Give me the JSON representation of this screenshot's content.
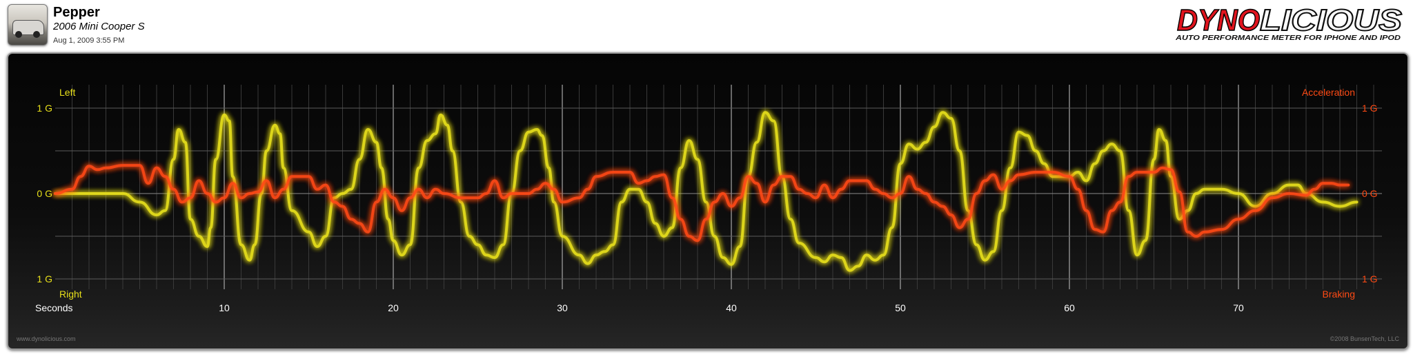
{
  "header": {
    "name": "Pepper",
    "model": "2006 Mini Cooper S",
    "date": "Aug 1, 2009 3:55 PM"
  },
  "brand": {
    "logo_part1": "DYNO",
    "logo_part2": "LICIOUS",
    "tagline": "AUTO PERFORMANCE METER FOR IPHONE AND IPOD"
  },
  "footer": {
    "left": "www.dynolicious.com",
    "right": "©2008 BunsenTech, LLC"
  },
  "colors": {
    "lateral": "#e8e01a",
    "longitudinal": "#ff4a14",
    "brand_red": "#e0141e"
  },
  "chart_data": {
    "type": "line",
    "xlabel": "Seconds",
    "x_ticks": [
      10,
      20,
      30,
      40,
      50,
      60,
      70
    ],
    "xlim": [
      0,
      78
    ],
    "ylim": [
      -1.1,
      1.1
    ],
    "grid": true,
    "left_axis": {
      "top_label": "Left",
      "bottom_label": "Right",
      "tick_labels": [
        "1 G",
        "0 G",
        "1 G"
      ]
    },
    "right_axis": {
      "top_label": "Acceleration",
      "bottom_label": "Braking",
      "tick_labels": [
        "1 G",
        "0 G",
        "1 G"
      ]
    },
    "series": [
      {
        "name": "Left",
        "color": "#e8e01a",
        "points": [
          [
            0,
            0
          ],
          [
            2,
            0
          ],
          [
            4,
            0
          ],
          [
            5,
            -0.1
          ],
          [
            6,
            -0.25
          ],
          [
            6.5,
            -0.2
          ],
          [
            7,
            0.4
          ],
          [
            7.3,
            0.75
          ],
          [
            7.7,
            0.6
          ],
          [
            8,
            -0.3
          ],
          [
            8.5,
            -0.5
          ],
          [
            9,
            -0.62
          ],
          [
            9.2,
            -0.4
          ],
          [
            9.5,
            0.4
          ],
          [
            10,
            0.92
          ],
          [
            10.3,
            0.85
          ],
          [
            10.5,
            0.2
          ],
          [
            11,
            -0.6
          ],
          [
            11.5,
            -0.78
          ],
          [
            11.8,
            -0.6
          ],
          [
            12.2,
            0
          ],
          [
            12.5,
            0.5
          ],
          [
            13,
            0.8
          ],
          [
            13.3,
            0.7
          ],
          [
            13.5,
            0.3
          ],
          [
            14,
            -0.2
          ],
          [
            15,
            -0.45
          ],
          [
            15.5,
            -0.62
          ],
          [
            16,
            -0.5
          ],
          [
            16.5,
            -0.05
          ],
          [
            17,
            0
          ],
          [
            17.5,
            0.05
          ],
          [
            18,
            0.4
          ],
          [
            18.5,
            0.75
          ],
          [
            19,
            0.6
          ],
          [
            19.3,
            0.3
          ],
          [
            19.7,
            -0.3
          ],
          [
            20,
            -0.55
          ],
          [
            20.5,
            -0.72
          ],
          [
            21,
            -0.6
          ],
          [
            21.5,
            0.3
          ],
          [
            22,
            0.62
          ],
          [
            22.5,
            0.7
          ],
          [
            22.8,
            0.92
          ],
          [
            23.2,
            0.8
          ],
          [
            23.5,
            0.5
          ],
          [
            24,
            -0.1
          ],
          [
            24.5,
            -0.5
          ],
          [
            25,
            -0.6
          ],
          [
            25.5,
            -0.72
          ],
          [
            26,
            -0.75
          ],
          [
            26.5,
            -0.6
          ],
          [
            27,
            0
          ],
          [
            27.5,
            0.5
          ],
          [
            28,
            0.72
          ],
          [
            28.5,
            0.75
          ],
          [
            28.8,
            0.68
          ],
          [
            29.2,
            0.3
          ],
          [
            29.5,
            -0.1
          ],
          [
            30,
            -0.5
          ],
          [
            31,
            -0.72
          ],
          [
            31.5,
            -0.82
          ],
          [
            32,
            -0.72
          ],
          [
            32.5,
            -0.68
          ],
          [
            33,
            -0.6
          ],
          [
            33.5,
            -0.1
          ],
          [
            34,
            0.05
          ],
          [
            34.5,
            0.05
          ],
          [
            35,
            -0.1
          ],
          [
            35.5,
            -0.35
          ],
          [
            36,
            -0.5
          ],
          [
            36.5,
            -0.4
          ],
          [
            37,
            0.3
          ],
          [
            37.5,
            0.62
          ],
          [
            38,
            0.4
          ],
          [
            38.5,
            -0.1
          ],
          [
            39,
            -0.5
          ],
          [
            39.5,
            -0.75
          ],
          [
            40,
            -0.83
          ],
          [
            40.5,
            -0.62
          ],
          [
            41,
            0.2
          ],
          [
            41.5,
            0.6
          ],
          [
            42,
            0.95
          ],
          [
            42.5,
            0.85
          ],
          [
            43,
            0.2
          ],
          [
            43.5,
            -0.3
          ],
          [
            44,
            -0.58
          ],
          [
            45,
            -0.75
          ],
          [
            45.5,
            -0.8
          ],
          [
            46,
            -0.72
          ],
          [
            46.5,
            -0.75
          ],
          [
            47,
            -0.9
          ],
          [
            47.5,
            -0.85
          ],
          [
            48,
            -0.72
          ],
          [
            48.5,
            -0.78
          ],
          [
            49,
            -0.72
          ],
          [
            49.5,
            -0.4
          ],
          [
            50,
            0.35
          ],
          [
            50.5,
            0.58
          ],
          [
            51,
            0.52
          ],
          [
            51.5,
            0.6
          ],
          [
            52,
            0.78
          ],
          [
            52.5,
            0.95
          ],
          [
            53,
            0.88
          ],
          [
            53.5,
            0.5
          ],
          [
            54,
            -0.2
          ],
          [
            54.5,
            -0.6
          ],
          [
            55,
            -0.78
          ],
          [
            55.5,
            -0.68
          ],
          [
            56,
            -0.2
          ],
          [
            56.5,
            0.3
          ],
          [
            57,
            0.72
          ],
          [
            57.5,
            0.68
          ],
          [
            58,
            0.5
          ],
          [
            58.5,
            0.35
          ],
          [
            59,
            0.2
          ],
          [
            59.5,
            0.2
          ],
          [
            60,
            0.2
          ],
          [
            60.5,
            0.25
          ],
          [
            61,
            0.15
          ],
          [
            61.5,
            0.35
          ],
          [
            62,
            0.5
          ],
          [
            62.5,
            0.58
          ],
          [
            63,
            0.5
          ],
          [
            63.5,
            -0.2
          ],
          [
            64,
            -0.72
          ],
          [
            64.5,
            -0.55
          ],
          [
            65,
            0.4
          ],
          [
            65.3,
            0.75
          ],
          [
            65.7,
            0.62
          ],
          [
            66,
            0.2
          ],
          [
            66.5,
            -0.3
          ],
          [
            67,
            -0.2
          ],
          [
            67.5,
            0
          ],
          [
            68,
            0.05
          ],
          [
            69,
            0.05
          ],
          [
            70,
            0
          ],
          [
            71,
            -0.15
          ],
          [
            72,
            0
          ],
          [
            73,
            0.1
          ],
          [
            73.5,
            0.1
          ],
          [
            74,
            0
          ],
          [
            75,
            -0.1
          ],
          [
            76,
            -0.15
          ],
          [
            77,
            -0.1
          ]
        ]
      },
      {
        "name": "Acceleration",
        "color": "#ff4a14",
        "points": [
          [
            0,
            0
          ],
          [
            1,
            0.05
          ],
          [
            1.5,
            0.2
          ],
          [
            2,
            0.32
          ],
          [
            2.5,
            0.28
          ],
          [
            3,
            0.3
          ],
          [
            4,
            0.33
          ],
          [
            5,
            0.33
          ],
          [
            5.5,
            0.12
          ],
          [
            6,
            0.3
          ],
          [
            6.5,
            0.2
          ],
          [
            7,
            0.05
          ],
          [
            7.5,
            -0.1
          ],
          [
            8,
            -0.05
          ],
          [
            8.5,
            0.15
          ],
          [
            9,
            0
          ],
          [
            9.5,
            -0.1
          ],
          [
            10,
            -0.05
          ],
          [
            10.5,
            0.12
          ],
          [
            11,
            -0.05
          ],
          [
            11.5,
            0
          ],
          [
            12,
            0.02
          ],
          [
            12.5,
            0.15
          ],
          [
            13,
            -0.05
          ],
          [
            13.5,
            0.05
          ],
          [
            14,
            0.2
          ],
          [
            15,
            0.2
          ],
          [
            15.5,
            0.05
          ],
          [
            16,
            0.1
          ],
          [
            16.5,
            -0.1
          ],
          [
            17,
            -0.15
          ],
          [
            17.5,
            -0.3
          ],
          [
            18,
            -0.35
          ],
          [
            18.5,
            -0.45
          ],
          [
            19,
            -0.1
          ],
          [
            19.5,
            0.05
          ],
          [
            20,
            -0.05
          ],
          [
            20.5,
            -0.2
          ],
          [
            21,
            -0.05
          ],
          [
            21.5,
            0.05
          ],
          [
            22,
            -0.05
          ],
          [
            22.5,
            0.05
          ],
          [
            23,
            0
          ],
          [
            24,
            -0.05
          ],
          [
            25,
            -0.05
          ],
          [
            25.5,
            0
          ],
          [
            26,
            0.15
          ],
          [
            26.5,
            -0.05
          ],
          [
            27,
            0
          ],
          [
            28,
            0
          ],
          [
            28.5,
            0.05
          ],
          [
            29,
            0.12
          ],
          [
            29.5,
            0.05
          ],
          [
            30,
            -0.1
          ],
          [
            31,
            -0.05
          ],
          [
            31.5,
            0.05
          ],
          [
            32,
            0.2
          ],
          [
            33,
            0.25
          ],
          [
            34,
            0.25
          ],
          [
            34.5,
            0.12
          ],
          [
            35,
            0.15
          ],
          [
            35.5,
            0.2
          ],
          [
            36,
            0.22
          ],
          [
            36.5,
            -0.05
          ],
          [
            37,
            -0.3
          ],
          [
            37.5,
            -0.5
          ],
          [
            38,
            -0.55
          ],
          [
            38.5,
            -0.3
          ],
          [
            39,
            -0.1
          ],
          [
            39.5,
            0
          ],
          [
            40,
            -0.15
          ],
          [
            40.5,
            -0.05
          ],
          [
            41,
            0.2
          ],
          [
            41.5,
            0.12
          ],
          [
            42,
            -0.1
          ],
          [
            42.5,
            0.1
          ],
          [
            43,
            0.2
          ],
          [
            43.5,
            0.2
          ],
          [
            44,
            0.05
          ],
          [
            44.5,
            0
          ],
          [
            45,
            -0.05
          ],
          [
            45.5,
            0.1
          ],
          [
            46,
            -0.05
          ],
          [
            46.5,
            0.05
          ],
          [
            47,
            0.15
          ],
          [
            48,
            0.15
          ],
          [
            48.5,
            0.05
          ],
          [
            49,
            0
          ],
          [
            49.5,
            -0.05
          ],
          [
            50,
            0
          ],
          [
            50.5,
            0.2
          ],
          [
            51,
            0.05
          ],
          [
            51.5,
            0
          ],
          [
            52,
            -0.1
          ],
          [
            52.5,
            -0.15
          ],
          [
            53,
            -0.25
          ],
          [
            53.5,
            -0.4
          ],
          [
            54,
            -0.3
          ],
          [
            54.5,
            0
          ],
          [
            55,
            0.15
          ],
          [
            55.5,
            0.22
          ],
          [
            56,
            0.05
          ],
          [
            56.5,
            0.15
          ],
          [
            57,
            0.22
          ],
          [
            58,
            0.25
          ],
          [
            59,
            0.25
          ],
          [
            60,
            0.2
          ],
          [
            60.5,
            0.05
          ],
          [
            61,
            -0.2
          ],
          [
            61.5,
            -0.42
          ],
          [
            62,
            -0.45
          ],
          [
            62.5,
            -0.2
          ],
          [
            63,
            -0.1
          ],
          [
            63.5,
            0.2
          ],
          [
            64,
            0.25
          ],
          [
            65,
            0.25
          ],
          [
            65.5,
            0.3
          ],
          [
            66,
            0.28
          ],
          [
            66.5,
            0.02
          ],
          [
            67,
            -0.45
          ],
          [
            67.5,
            -0.5
          ],
          [
            68,
            -0.45
          ],
          [
            69,
            -0.42
          ],
          [
            70,
            -0.3
          ],
          [
            71,
            -0.2
          ],
          [
            72,
            -0.05
          ],
          [
            73,
            0
          ],
          [
            74,
            -0.02
          ],
          [
            74.5,
            0.05
          ],
          [
            75,
            0.12
          ],
          [
            75.5,
            0.12
          ],
          [
            76,
            0.1
          ],
          [
            76.5,
            0.1
          ]
        ]
      }
    ]
  }
}
